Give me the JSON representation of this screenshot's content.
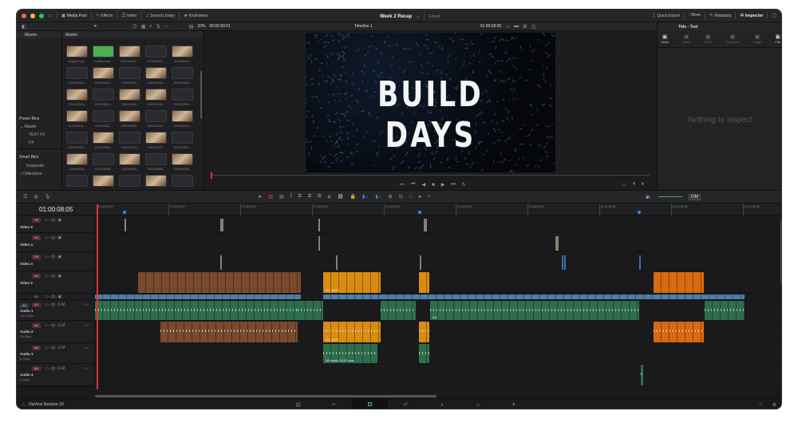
{
  "topbar": {
    "media_pool": "Media Pool",
    "effects": "Effects",
    "index": "Index",
    "sound_library": "Sound Library",
    "keyframes": "Keyframes",
    "project_title": "Week 2 Recap",
    "project_status": "Edited",
    "quick_export": "Quick Export",
    "mixer": "Mixer",
    "metadata": "Metadata",
    "inspector": "Inspector"
  },
  "toolbar2": {
    "zoom": "33%",
    "source_timecode": "00:00:00:01",
    "timeline_name": "Timeline 1",
    "record_timecode": "01:00:08:05"
  },
  "bins": {
    "header": "Master",
    "power_bins": "Power Bins",
    "power_items": [
      "Master",
      "TEXT FX",
      "FX"
    ],
    "smart_bins": "Smart Bins",
    "smart_items": [
      "Keywords",
      "Collections"
    ]
  },
  "media_pool": {
    "header": "Master",
    "clips": [
      "Edgy-Fl-gh...",
      "audio proof...",
      "GX010513-...",
      "GX010513-...",
      "GX010514...",
      "GX010515...",
      "GX010515...",
      "GX010516...",
      "GX010516...",
      "GX010516...",
      "GX010519...",
      "GX010519...",
      "GX010520...",
      "GX010520...",
      "GX010520...",
      "GX010521...",
      "GX010521...",
      "GX010522...",
      "GX010522...",
      "GX010523...",
      "GX010523...",
      "GX010524...",
      "GX010524...",
      "GX010527...",
      "GX010527...",
      "GX010528...",
      "GX010528...",
      "GX010528...",
      "GX010528...",
      "GX010530...",
      "",
      "",
      "",
      "",
      ""
    ]
  },
  "viewer": {
    "title_text": "BUILD DAYS"
  },
  "inspector": {
    "title": "Title - Text",
    "tabs": [
      "Video",
      "Audio",
      "Effect",
      "Transition",
      "Image",
      "File"
    ],
    "empty": "Nothing to inspect"
  },
  "timeline": {
    "timecode": "01:00:08:05",
    "ruler": [
      "01:00:00:00",
      "01:03:00:00",
      "01:06:00:00",
      "01:09:00:00",
      "01:12:00:00",
      "01:15:00:00",
      "01:18:00:00",
      "01:21:00:00",
      "01:24:00:00",
      "01:27:00:00"
    ],
    "tracks": [
      {
        "tag": "V5",
        "name": "Video 5",
        "sub": ""
      },
      {
        "tag": "V4",
        "name": "Video 4",
        "sub": ""
      },
      {
        "tag": "V3",
        "name": "Video 3",
        "sub": ""
      },
      {
        "tag": "V2",
        "name": "Video 2",
        "sub": ""
      },
      {
        "tag": "V1",
        "name": "",
        "sub": ""
      },
      {
        "tag": "A1",
        "name": "Audio 1",
        "sub": "140 Clips",
        "level": "2.0"
      },
      {
        "tag": "A2",
        "name": "Audio 2",
        "sub": "75 Clips",
        "level": "2.0"
      },
      {
        "tag": "A3",
        "name": "Audio 3",
        "sub": "5 Clips",
        "level": "2.0"
      },
      {
        "tag": "A4",
        "name": "Audio 4",
        "sub": "4 Clips",
        "level": "1.0"
      }
    ],
    "clip_labels": {
      "v2a": "GX...",
      "v2b": "GX...",
      "v2c": "GX_0327...",
      "a2a": "GX...",
      "a2b": "GX_0327...",
      "a3": "48 music-02-01.wav",
      "a1a": "Wi..."
    },
    "dim": "DIM"
  },
  "footer": {
    "app": "DaVinci Resolve 20"
  }
}
